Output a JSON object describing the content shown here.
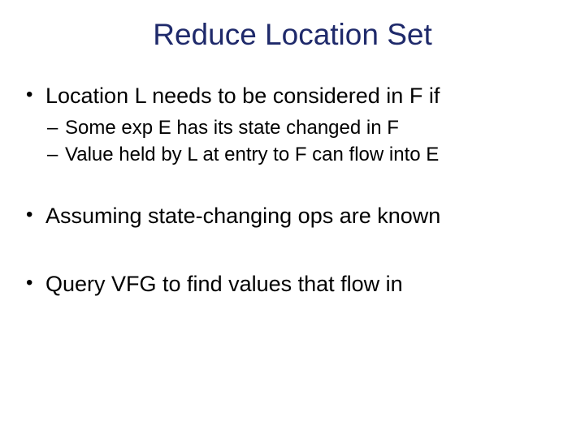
{
  "title": "Reduce Location Set",
  "bullets": {
    "b1": "Location L needs to be considered in F if",
    "b1_sub1": "Some exp E has its state changed in F",
    "b1_sub2": "Value held by L at entry to F can flow into E",
    "b2": "Assuming state-changing ops are known",
    "b3": "Query VFG to find values that flow in"
  }
}
